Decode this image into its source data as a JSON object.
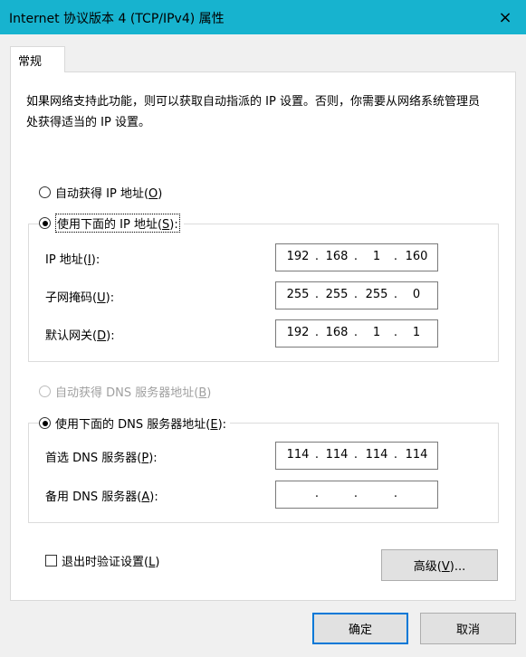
{
  "window": {
    "title": "Internet 协议版本 4 (TCP/IPv4) 属性",
    "close_icon": "×"
  },
  "tabs": [
    {
      "label": "常规"
    }
  ],
  "description": "如果网络支持此功能，则可以获取自动指派的 IP 设置。否则，你需要从网络系统管理员处获得适当的 IP 设置。",
  "ip_section": {
    "auto": {
      "label": "自动获得 IP 地址",
      "key": "O",
      "checked": false
    },
    "manual": {
      "label": "使用下面的 IP 地址",
      "key": "S",
      "checked": true
    },
    "fields": [
      {
        "label": "IP 地址",
        "key": "I",
        "octets": [
          "192",
          "168",
          "1",
          "160"
        ]
      },
      {
        "label": "子网掩码",
        "key": "U",
        "octets": [
          "255",
          "255",
          "255",
          "0"
        ]
      },
      {
        "label": "默认网关",
        "key": "D",
        "octets": [
          "192",
          "168",
          "1",
          "1"
        ]
      }
    ]
  },
  "dns_section": {
    "auto": {
      "label": "自动获得 DNS 服务器地址",
      "key": "B",
      "checked": false,
      "disabled": true
    },
    "manual": {
      "label": "使用下面的 DNS 服务器地址",
      "key": "E",
      "checked": true
    },
    "fields": [
      {
        "label": "首选 DNS 服务器",
        "key": "P",
        "octets": [
          "114",
          "114",
          "114",
          "114"
        ]
      },
      {
        "label": "备用 DNS 服务器",
        "key": "A",
        "octets": [
          "",
          "",
          "",
          ""
        ]
      }
    ]
  },
  "validate": {
    "label": "退出时验证设置",
    "key": "L",
    "checked": false
  },
  "buttons": {
    "advanced": {
      "label": "高级",
      "key": "V",
      "suffix": "..."
    },
    "ok": "确定",
    "cancel": "取消"
  },
  "paren_open": "(",
  "paren_close": ")",
  "colon": ":",
  "octet_sep": "."
}
